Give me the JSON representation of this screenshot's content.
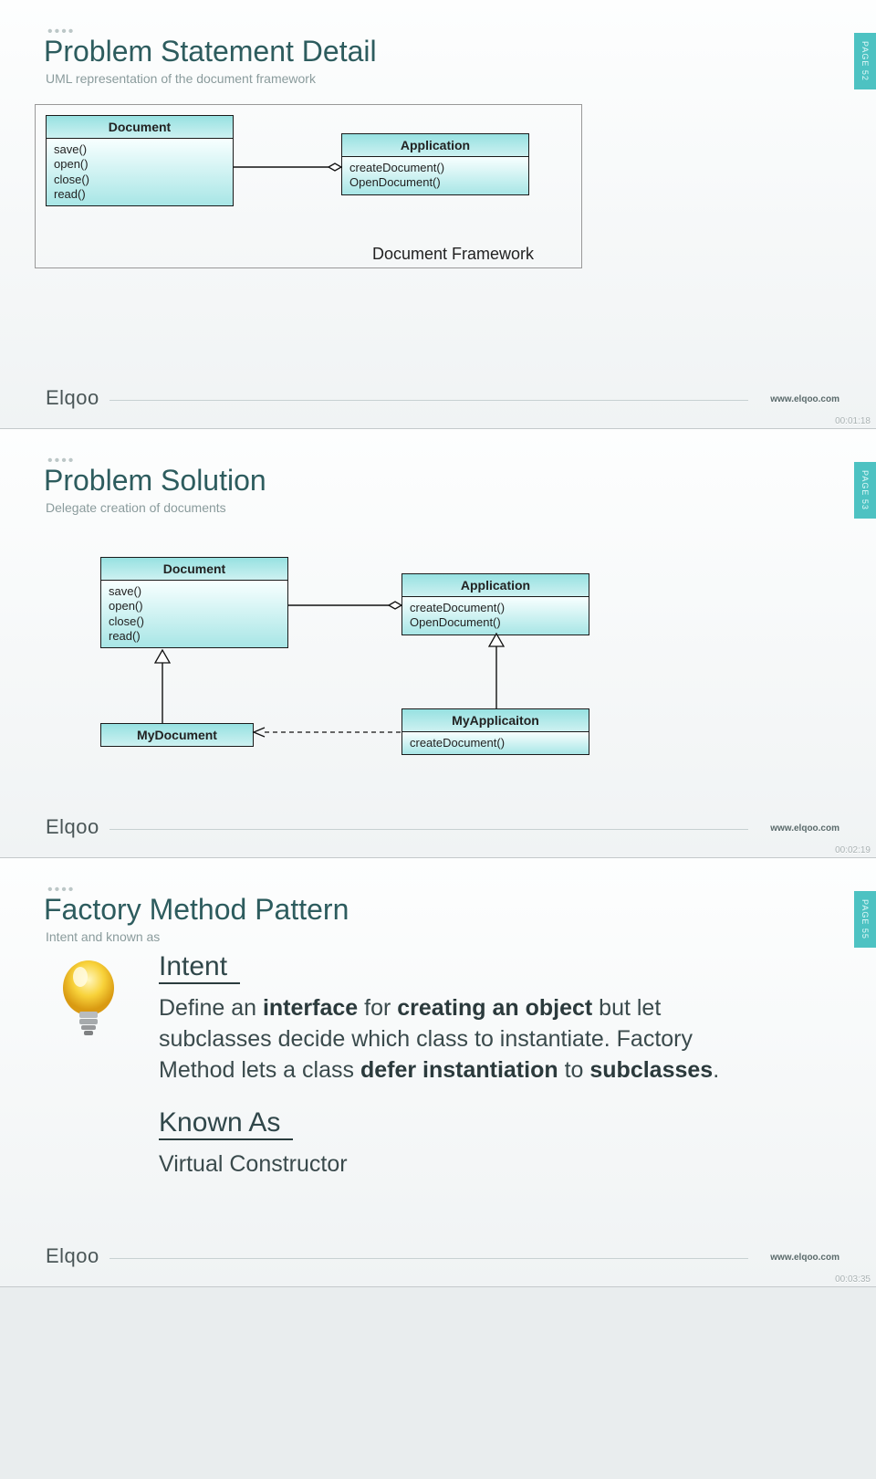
{
  "brand": "Elqoo",
  "url": "www.elqoo.com",
  "slides": [
    {
      "page": "PAGE 52",
      "title": "Problem Statement Detail",
      "subtitle": "UML representation of the document framework",
      "timestamp": "00:01:18",
      "frame_label": "Document Framework",
      "uml": {
        "document": {
          "name": "Document",
          "methods": [
            "save()",
            "open()",
            "close()",
            "read()"
          ]
        },
        "application": {
          "name": "Application",
          "methods": [
            "createDocument()",
            "OpenDocument()"
          ]
        }
      }
    },
    {
      "page": "PAGE 53",
      "title": "Problem Solution",
      "subtitle": "Delegate creation of documents",
      "timestamp": "00:02:19",
      "uml": {
        "document": {
          "name": "Document",
          "methods": [
            "save()",
            "open()",
            "close()",
            "read()"
          ]
        },
        "application": {
          "name": "Application",
          "methods": [
            "createDocument()",
            "OpenDocument()"
          ]
        },
        "mydocument": {
          "name": "MyDocument"
        },
        "myapplication": {
          "name": "MyApplicaiton",
          "methods": [
            "createDocument()"
          ]
        }
      }
    },
    {
      "page": "PAGE 55",
      "title": "Factory Method Pattern",
      "subtitle": "Intent and known as",
      "timestamp": "00:03:35",
      "intent_label": "Intent",
      "intent_text_parts": [
        {
          "t": "Define an ",
          "b": false
        },
        {
          "t": "interface",
          "b": true
        },
        {
          "t": " for ",
          "b": false
        },
        {
          "t": "creating an object",
          "b": true
        },
        {
          "t": " but let subclasses decide which class to instantiate. Factory Method lets a class ",
          "b": false
        },
        {
          "t": "defer instantiation",
          "b": true
        },
        {
          "t": " to ",
          "b": false
        },
        {
          "t": "subclasses",
          "b": true
        },
        {
          "t": ".",
          "b": false
        }
      ],
      "known_as_label": "Known As",
      "known_as_text": "Virtual Constructor"
    }
  ]
}
